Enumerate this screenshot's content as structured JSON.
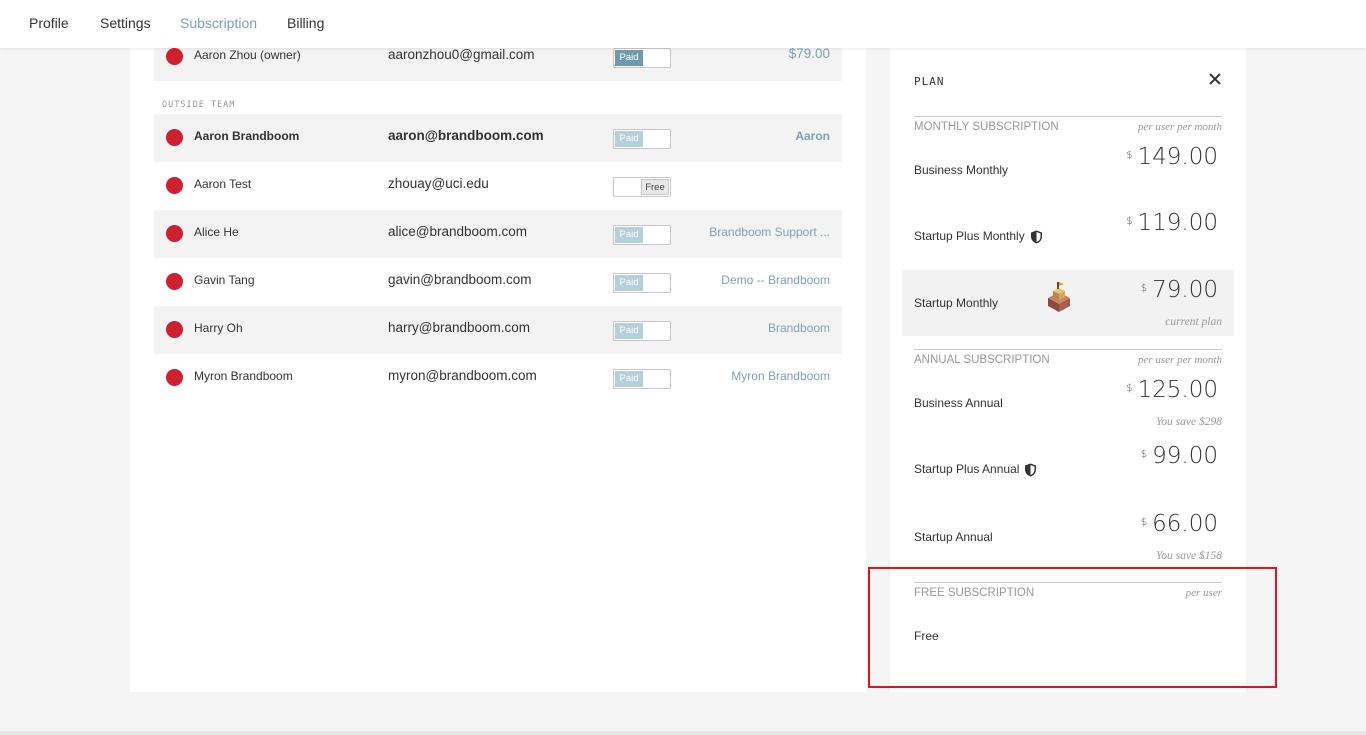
{
  "nav": {
    "tabs": [
      {
        "label": "Profile"
      },
      {
        "label": "Settings"
      },
      {
        "label": "Subscription"
      },
      {
        "label": "Billing"
      }
    ]
  },
  "members": {
    "owner": {
      "name": "Aaron Zhou (owner)",
      "email": "aaronzhou0@gmail.com",
      "status": "Paid",
      "value": "$79.00"
    },
    "section_label": "OUTSIDE TEAM",
    "rows": [
      {
        "name": "Aaron Brandboom",
        "email": "aaron@brandboom.com",
        "status": "Paid",
        "value": "Aaron"
      },
      {
        "name": "Aaron Test",
        "email": "zhouay@uci.edu",
        "status": "Free",
        "value": ""
      },
      {
        "name": "Alice He",
        "email": "alice@brandboom.com",
        "status": "Paid",
        "value": "Brandboom Support ..."
      },
      {
        "name": "Gavin Tang",
        "email": "gavin@brandboom.com",
        "status": "Paid",
        "value": "Demo -- Brandboom"
      },
      {
        "name": "Harry Oh",
        "email": "harry@brandboom.com",
        "status": "Paid",
        "value": "Brandboom"
      },
      {
        "name": "Myron Brandboom",
        "email": "myron@brandboom.com",
        "status": "Paid",
        "value": "Myron Brandboom"
      }
    ]
  },
  "plan_panel": {
    "title": "PLAN",
    "currency": "$",
    "monthly": {
      "heading": "MONTHLY SUBSCRIPTION",
      "unit": "per user per month",
      "plans": [
        {
          "name": "Business Monthly",
          "price": "149.00"
        },
        {
          "name": "Startup Plus Monthly",
          "price": "119.00"
        },
        {
          "name": "Startup Monthly",
          "price": "79.00",
          "note": "current plan"
        }
      ]
    },
    "annual": {
      "heading": "ANNUAL SUBSCRIPTION",
      "unit": "per user per month",
      "plans": [
        {
          "name": "Business Annual",
          "price": "125.00",
          "note": "You save $298"
        },
        {
          "name": "Startup Plus Annual",
          "price": "99.00"
        },
        {
          "name": "Startup Annual",
          "price": "66.00",
          "note": "You save $158"
        }
      ]
    },
    "free": {
      "heading": "FREE SUBSCRIPTION",
      "unit": "per user",
      "plans": [
        {
          "name": "Free"
        }
      ]
    }
  },
  "colors": {
    "accent": "#7aa3b8",
    "status_dot": "#d0202e",
    "highlight": "#e0141e"
  }
}
